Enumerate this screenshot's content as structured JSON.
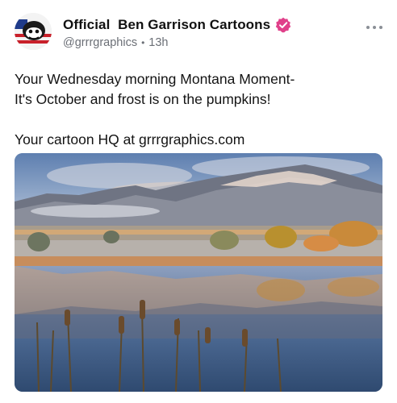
{
  "author": {
    "display_name": "Official  Ben Garrison Cartoons",
    "handle": "@grrrgraphics",
    "time": "13h",
    "separator": "•"
  },
  "post": {
    "lines": [
      "Your Wednesday morning Montana Moment-",
      "It's October and frost is on the pumpkins!",
      "",
      "Your cartoon HQ at grrrgraphics.com"
    ]
  },
  "icons": {
    "verified": "verified-badge-icon",
    "more": "more-options-icon",
    "avatar": "avatar-image"
  },
  "colors": {
    "verified_badge": "#e0408a",
    "meta_text": "#6b6f76"
  },
  "media": {
    "description_type": "landscape photo"
  }
}
